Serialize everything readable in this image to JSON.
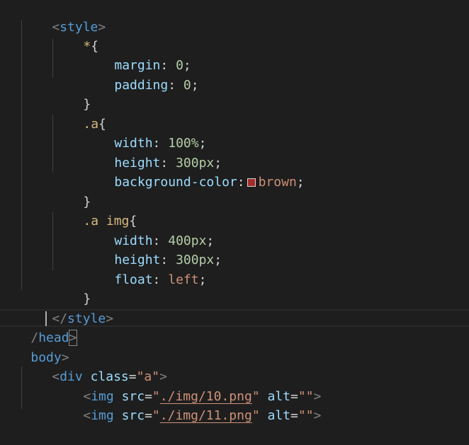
{
  "editor": {
    "colors": {
      "background": "#1e1e1e",
      "swatch": "#a52a2a"
    },
    "lines": [
      {
        "l": "<",
        "n": "style",
        "r": ">"
      },
      {
        "sel": "*",
        "brace": "{"
      },
      {
        "prop": "margin",
        "val": "0"
      },
      {
        "prop": "padding",
        "val": "0"
      },
      {
        "brace": "}"
      },
      {
        "sel": ".a",
        "brace": "{"
      },
      {
        "prop": "width",
        "val": "100%"
      },
      {
        "prop": "height",
        "val": "300px"
      },
      {
        "prop": "background-color",
        "val": "brown"
      },
      {
        "brace": "}"
      },
      {
        "sel": ".a img",
        "brace": "{"
      },
      {
        "prop": "width",
        "val": "400px"
      },
      {
        "prop": "height",
        "val": "300px"
      },
      {
        "prop": "float",
        "val": "left"
      },
      {
        "brace": "}"
      },
      {
        "l": "</",
        "n": "style",
        "r": ">"
      },
      {
        "l": "/",
        "n": "head",
        "r": ">"
      },
      {
        "n": "body",
        "r": ">"
      },
      {
        "l": "<",
        "n": "div",
        "attr": "class",
        "eq": "=",
        "q": "\"a\"",
        "r": ">"
      },
      {
        "l": "<",
        "n": "img",
        "attr": "src",
        "eq": "=",
        "q1": "\"",
        "path": "./img/10.png",
        "q2": "\"",
        "alt": "alt",
        "eq2": "=",
        "q3": "\"\"",
        "r": ">"
      },
      {
        "l": "<",
        "n": "img",
        "attr": "src",
        "eq": "=",
        "q1": "\"",
        "path": "./img/11.png",
        "q2": "\"",
        "alt": "alt",
        "eq2": "=",
        "q3": "\"\"",
        "r": ">"
      }
    ],
    "punct": {
      "colon": ":",
      "semi": ";"
    }
  }
}
